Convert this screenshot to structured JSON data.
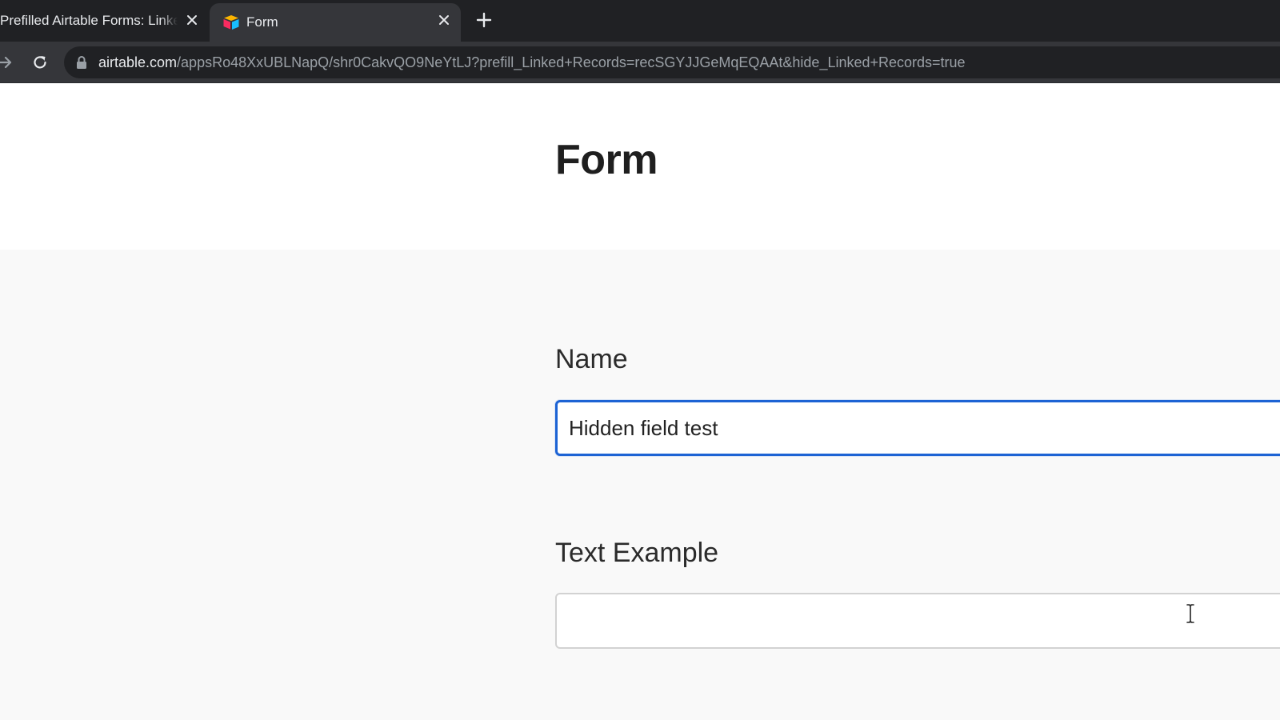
{
  "browser": {
    "tabs": [
      {
        "title": "Prefilled Airtable Forms: Linked",
        "active": false
      },
      {
        "title": "Form",
        "active": true
      }
    ],
    "address_bar": {
      "host": "airtable.com",
      "path": "/appsRo48XxUBLNapQ/shr0CakvQO9NeYtLJ?prefill_Linked+Records=recSGYJJGeMqEQAAt&hide_Linked+Records=true"
    },
    "icons": {
      "close": "close-icon",
      "new_tab": "plus-icon",
      "forward": "forward-arrow-icon",
      "reload": "reload-icon",
      "lock": "lock-icon",
      "favicon": "airtable-logo-icon"
    }
  },
  "form": {
    "title": "Form",
    "fields": [
      {
        "label": "Name",
        "value": "Hidden field test",
        "focused": true
      },
      {
        "label": "Text Example",
        "value": "",
        "focused": false
      }
    ]
  },
  "colors": {
    "focus_border": "#1d63d4",
    "tabstrip_bg": "#202124",
    "toolbar_bg": "#35363a",
    "page_bg": "#f9f9f9"
  }
}
